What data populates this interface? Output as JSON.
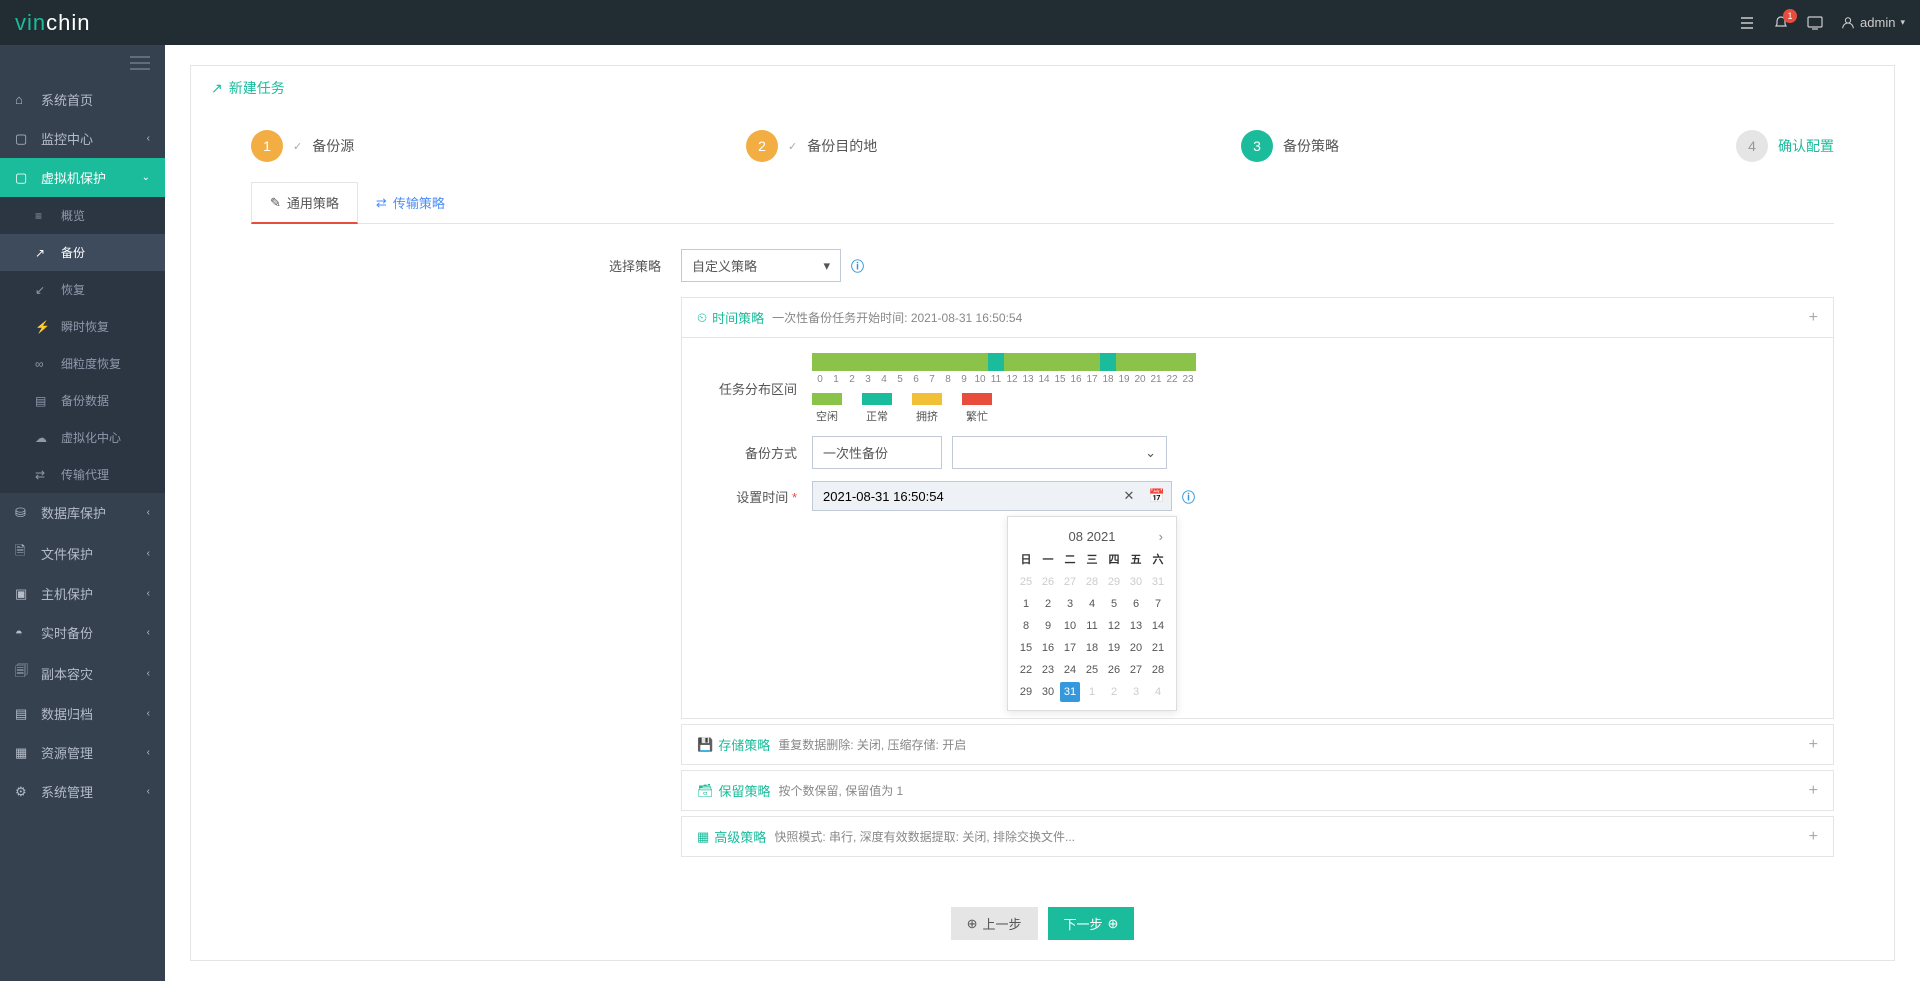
{
  "header": {
    "logo_prefix": "vin",
    "logo_suffix": "chin",
    "notif_count": "1",
    "user_label": "admin"
  },
  "sidebar": {
    "items": [
      {
        "label": "系统首页"
      },
      {
        "label": "监控中心"
      },
      {
        "label": "虚拟机保护"
      },
      {
        "label": "数据库保护"
      },
      {
        "label": "文件保护"
      },
      {
        "label": "主机保护"
      },
      {
        "label": "实时备份"
      },
      {
        "label": "副本容灾"
      },
      {
        "label": "数据归档"
      },
      {
        "label": "资源管理"
      },
      {
        "label": "系统管理"
      }
    ],
    "subitems": [
      {
        "label": "概览"
      },
      {
        "label": "备份"
      },
      {
        "label": "恢复"
      },
      {
        "label": "瞬时恢复"
      },
      {
        "label": "细粒度恢复"
      },
      {
        "label": "备份数据"
      },
      {
        "label": "虚拟化中心"
      },
      {
        "label": "传输代理"
      }
    ]
  },
  "page": {
    "title": "新建任务"
  },
  "wizard": {
    "steps": [
      {
        "num": "1",
        "label": "备份源"
      },
      {
        "num": "2",
        "label": "备份目的地"
      },
      {
        "num": "3",
        "label": "备份策略"
      },
      {
        "num": "4",
        "label": "确认配置"
      }
    ]
  },
  "tabs": {
    "general": "通用策略",
    "transfer": "传输策略"
  },
  "form": {
    "select_policy_label": "选择策略",
    "select_policy_value": "自定义策略",
    "time_policy": {
      "title": "时间策略",
      "desc": "一次性备份任务开始时间: 2021-08-31 16:50:54",
      "dist_label": "任务分布区间",
      "hours": [
        "0",
        "1",
        "2",
        "3",
        "4",
        "5",
        "6",
        "7",
        "8",
        "9",
        "10",
        "11",
        "12",
        "13",
        "14",
        "15",
        "16",
        "17",
        "18",
        "19",
        "20",
        "21",
        "22",
        "23"
      ],
      "legend": [
        {
          "label": "空闲",
          "color": "#8bc34a"
        },
        {
          "label": "正常",
          "color": "#1bbc9b"
        },
        {
          "label": "拥挤",
          "color": "#f2c037"
        },
        {
          "label": "繁忙",
          "color": "#e74c3c"
        }
      ],
      "method_label": "备份方式",
      "method_value": "一次性备份",
      "settime_label": "设置时间",
      "settime_value": "2021-08-31 16:50:54"
    },
    "storage_policy": {
      "title": "存储策略",
      "desc": "重复数据删除: 关闭, 压缩存储: 开启"
    },
    "retain_policy": {
      "title": "保留策略",
      "desc": "按个数保留, 保留值为 1"
    },
    "advanced_policy": {
      "title": "高级策略",
      "desc": "快照模式: 串行, 深度有效数据提取: 关闭, 排除交换文件..."
    }
  },
  "calendar": {
    "month_label": "08 2021",
    "dow": [
      "日",
      "一",
      "二",
      "三",
      "四",
      "五",
      "六"
    ],
    "prev_days": [
      "25",
      "26",
      "27",
      "28",
      "29",
      "30",
      "31"
    ],
    "days": [
      "1",
      "2",
      "3",
      "4",
      "5",
      "6",
      "7",
      "8",
      "9",
      "10",
      "11",
      "12",
      "13",
      "14",
      "15",
      "16",
      "17",
      "18",
      "19",
      "20",
      "21",
      "22",
      "23",
      "24",
      "25",
      "26",
      "27",
      "28",
      "29",
      "30",
      "31"
    ],
    "next_days": [
      "1",
      "2",
      "3",
      "4"
    ],
    "selected": "31"
  },
  "footer": {
    "prev": "上一步",
    "next": "下一步"
  }
}
